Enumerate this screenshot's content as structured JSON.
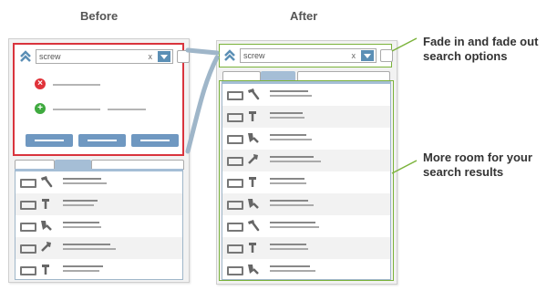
{
  "headings": {
    "before": "Before",
    "after": "After"
  },
  "annotations": {
    "fade": "Fade in and fade out search options",
    "room": "More room for your search results"
  },
  "search": {
    "value": "screw",
    "clear": "x"
  },
  "colors": {
    "panel_red": "#d9343d",
    "callout_green": "#7bb33b",
    "connector_blue": "#9fb6c9",
    "button_blue": "#6f98c1",
    "tab_blue": "#a5bed6",
    "remove_red": "#e0333a",
    "add_green": "#3faa3f"
  },
  "before": {
    "option_rows": [
      {
        "icon": "remove-icon"
      },
      {
        "icon": "add-icon"
      }
    ],
    "buttons": 3,
    "results": [
      "hammer-icon",
      "screwdriver-icon",
      "drill-icon",
      "wrench-icon",
      "screwdriver-icon"
    ]
  },
  "after": {
    "results": [
      "hammer-icon",
      "screwdriver-icon",
      "drill-icon",
      "wrench-icon",
      "screwdriver-icon",
      "drill-icon",
      "hammer-icon",
      "screwdriver-icon",
      "drill-icon"
    ]
  }
}
